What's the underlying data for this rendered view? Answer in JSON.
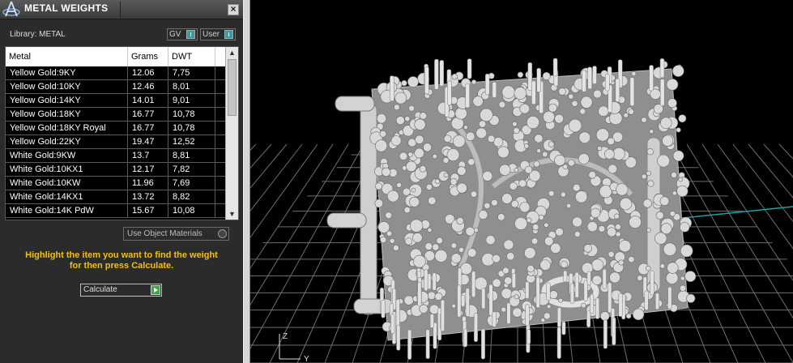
{
  "window": {
    "title": "METAL WEIGHTS",
    "close_glyph": "×"
  },
  "library": {
    "label": "Library: METAL"
  },
  "toggles": [
    {
      "label": "GV"
    },
    {
      "label": "User"
    }
  ],
  "table": {
    "columns": [
      "Metal",
      "Grams",
      "DWT"
    ],
    "rows": [
      [
        "Yellow Gold:9KY",
        "12.06",
        "7,75"
      ],
      [
        "Yellow Gold:10KY",
        "12.46",
        "8,01"
      ],
      [
        "Yellow Gold:14KY",
        "14.01",
        "9,01"
      ],
      [
        "Yellow Gold:18KY",
        "16.77",
        "10,78"
      ],
      [
        "Yellow Gold:18KY Royal",
        "16.77",
        "10,78"
      ],
      [
        "Yellow Gold:22KY",
        "19.47",
        "12,52"
      ],
      [
        "White Gold:9KW",
        "13.7",
        "8,81"
      ],
      [
        "White Gold:10KX1",
        "12.17",
        "7,82"
      ],
      [
        "White Gold:10KW",
        "11.96",
        "7,69"
      ],
      [
        "White Gold:14KX1",
        "13.72",
        "8,82"
      ],
      [
        "White Gold:14K PdW",
        "15.67",
        "10,08"
      ]
    ],
    "scroll_up_glyph": "▲",
    "scroll_down_glyph": "▼"
  },
  "use_object_materials": {
    "label": "Use Object Materials"
  },
  "instruction": {
    "line1": "Highlight the item you want to find the weight",
    "line2": "for then press Calculate."
  },
  "calculate": {
    "label": "Calculate"
  },
  "viewport": {
    "axis_labels": {
      "z": "Z",
      "y": "Y"
    },
    "colors": {
      "grid": "#6e6e6e",
      "model": "#d9d9d9",
      "background": "#000000",
      "axis_x": "#c0191a",
      "axis_y": "#1aa3a8"
    }
  },
  "icons": [
    "app-logo-icon",
    "close-icon",
    "scroll-up-icon",
    "scroll-down-icon",
    "toggle-knob-icon",
    "play-icon"
  ]
}
